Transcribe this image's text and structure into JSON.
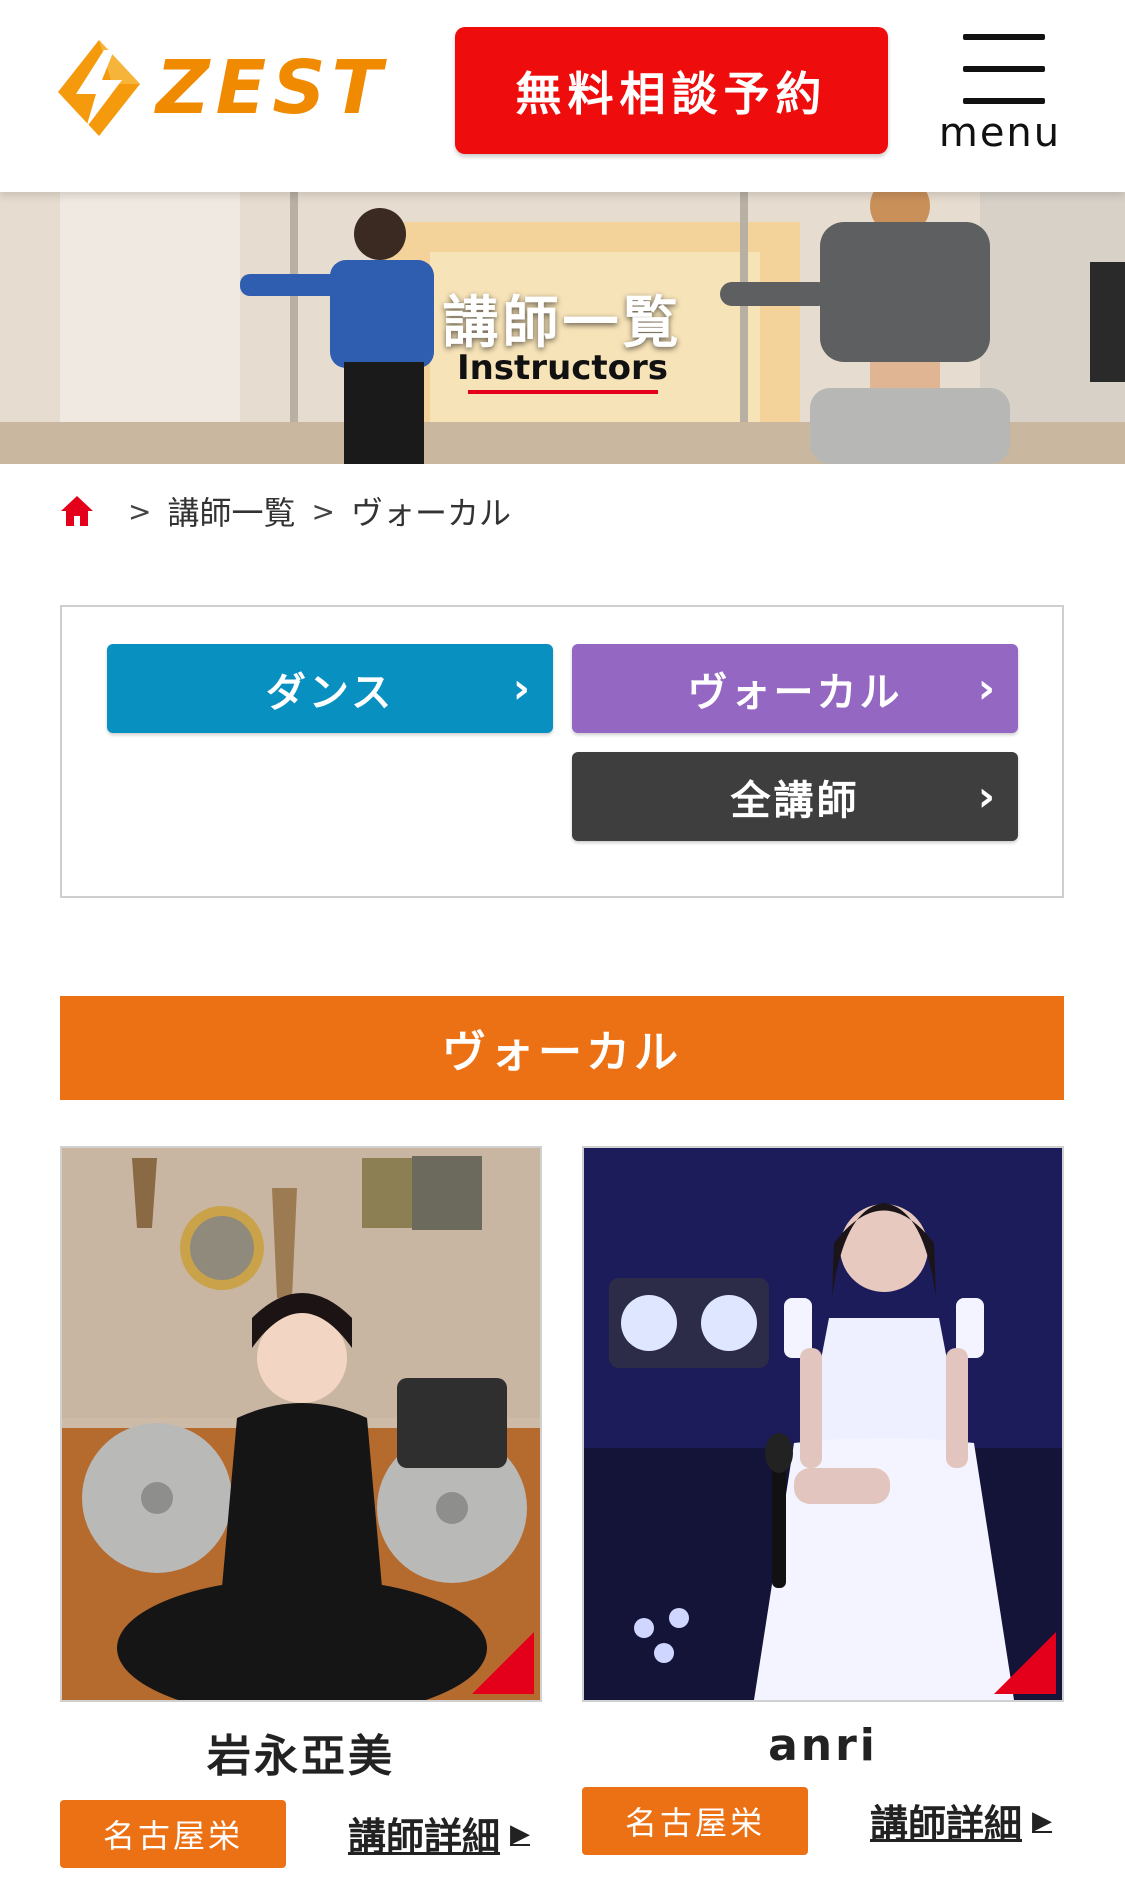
{
  "header": {
    "logo_text": "ZEST",
    "cta_label": "無料相談予約",
    "menu_label": "menu"
  },
  "hero": {
    "title": "講師一覧",
    "subtitle": "Instructors"
  },
  "breadcrumb": {
    "items": [
      "講師一覧",
      "ヴォーカル"
    ],
    "separator": ">"
  },
  "categories": {
    "dance": "ダンス",
    "vocal": "ヴォーカル",
    "all": "全講師",
    "chevron": "›"
  },
  "section": {
    "title": "ヴォーカル"
  },
  "instructors": [
    {
      "name": "岩永亞美",
      "location": "名古屋栄",
      "detail_label": "講師詳細"
    },
    {
      "name": "anri",
      "location": "名古屋栄",
      "detail_label": "講師詳細"
    }
  ],
  "colors": {
    "brand_orange": "#f08a00",
    "cta_red": "#ee0c0c",
    "section_orange": "#ec7014",
    "dance_blue": "#0890c0",
    "vocal_purple": "#9467c2",
    "all_dark": "#3e3e3e"
  },
  "icons": {
    "home": "home-icon",
    "menu": "hamburger-icon",
    "detail_arrow": "triangle-right-icon"
  }
}
